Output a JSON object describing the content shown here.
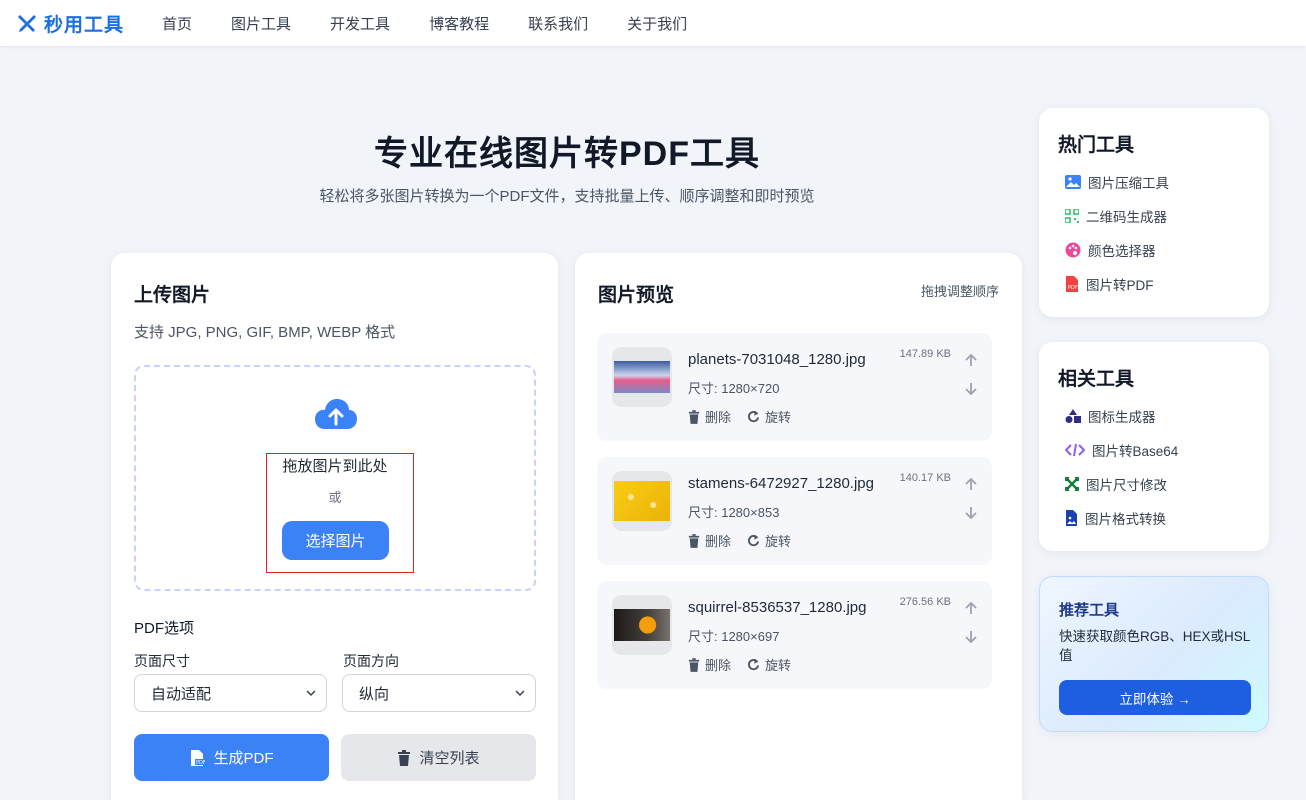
{
  "nav": {
    "logo": "秒用工具",
    "items": [
      "首页",
      "图片工具",
      "开发工具",
      "博客教程",
      "联系我们",
      "关于我们"
    ]
  },
  "hero": {
    "title": "专业在线图片转PDF工具",
    "subtitle": "轻松将多张图片转换为一个PDF文件，支持批量上传、顺序调整和即时预览"
  },
  "upload": {
    "title": "上传图片",
    "formats": "支持 JPG, PNG, GIF, BMP, WEBP 格式",
    "drop_text": "拖放图片到此处",
    "or_text": "或",
    "select_button": "选择图片",
    "pdf_options_title": "PDF选项",
    "page_size_label": "页面尺寸",
    "page_size_value": "自动适配",
    "orientation_label": "页面方向",
    "orientation_value": "纵向",
    "generate_button": "生成PDF",
    "clear_button": "清空列表"
  },
  "preview": {
    "title": "图片预览",
    "drag_hint": "拖拽调整顺序",
    "delete_label": "删除",
    "rotate_label": "旋转",
    "files": [
      {
        "name": "planets-7031048_1280.jpg",
        "size": "147.89 KB",
        "dims": "尺寸: 1280×720"
      },
      {
        "name": "stamens-6472927_1280.jpg",
        "size": "140.17 KB",
        "dims": "尺寸: 1280×853"
      },
      {
        "name": "squirrel-8536537_1280.jpg",
        "size": "276.56 KB",
        "dims": "尺寸: 1280×697"
      }
    ]
  },
  "hot_tools": {
    "title": "热门工具",
    "items": [
      "图片压缩工具",
      "二维码生成器",
      "颜色选择器",
      "图片转PDF"
    ]
  },
  "related_tools": {
    "title": "相关工具",
    "items": [
      "图标生成器",
      "图片转Base64",
      "图片尺寸修改",
      "图片格式转换"
    ]
  },
  "promo": {
    "title": "推荐工具",
    "desc": "快速获取颜色RGB、HEX或HSL值",
    "button": "立即体验 →"
  },
  "colors": {
    "primary": "#3b82f6",
    "brand": "#1d6fe0",
    "highlight_border": "#dc2626"
  }
}
